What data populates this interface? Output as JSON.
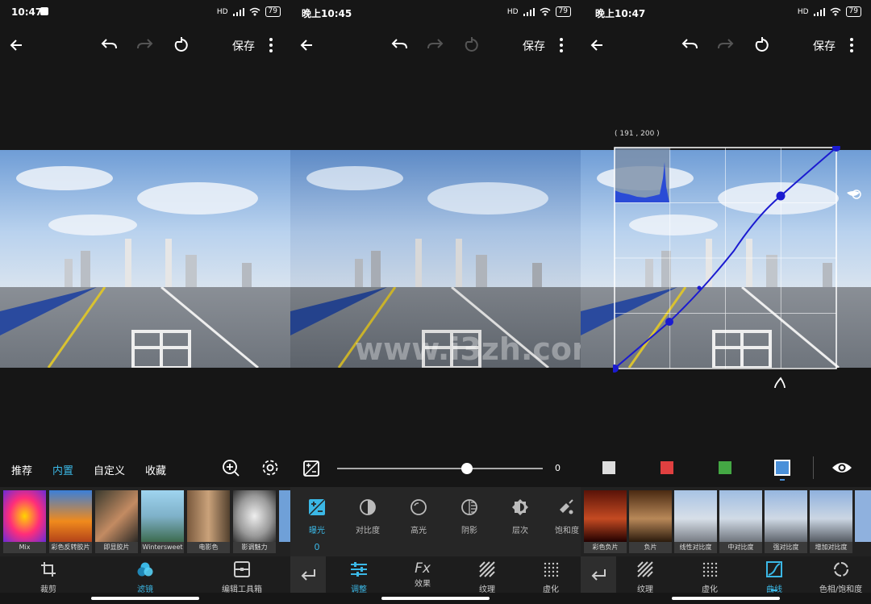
{
  "panels": [
    {
      "time": "10:47",
      "signal": "HD",
      "battery": "79"
    },
    {
      "time": "晚上10:45",
      "signal": "HD",
      "battery": "79"
    },
    {
      "time": "晚上10:47",
      "signal": "HD",
      "battery": "79"
    }
  ],
  "toolbar": {
    "save_label": "保存"
  },
  "watermark": "www.i3zh.com",
  "filters": {
    "tabs": [
      "推荐",
      "内置",
      "自定义",
      "收藏"
    ],
    "active_tab": "内置",
    "thumbs": [
      "Mix",
      "彩色反转胶片",
      "即显胶片",
      "Wintersweet",
      "电影色",
      "影调魅力"
    ],
    "bottom": [
      "裁剪",
      "滤镜",
      "编辑工具箱"
    ],
    "active_bottom": "滤镜"
  },
  "adjust": {
    "slider_value": "0",
    "slider_fraction": 0.63,
    "tools": [
      "曝光",
      "对比度",
      "高光",
      "阴影",
      "层次",
      "饱和度"
    ],
    "active_tool": "曝光",
    "active_value": "0",
    "bottom": [
      "调整",
      "效果",
      "纹理",
      "虚化"
    ],
    "active_bottom": "调整"
  },
  "curves": {
    "coordinate": "( 191 , 200 )",
    "channels": [
      "white",
      "red",
      "green",
      "blue"
    ],
    "channel_colors": [
      "#dddddd",
      "#e04040",
      "#44a844",
      "#4a90d9"
    ],
    "active_channel": "blue",
    "curve_color": "#1b1bd0",
    "presets": [
      "彩色负片",
      "负片",
      "线性对比度",
      "中对比度",
      "强对比度",
      "增加对比度"
    ],
    "bottom": [
      "纹理",
      "虚化",
      "曲线",
      "色相/饱和度"
    ],
    "active_bottom": "曲线"
  }
}
